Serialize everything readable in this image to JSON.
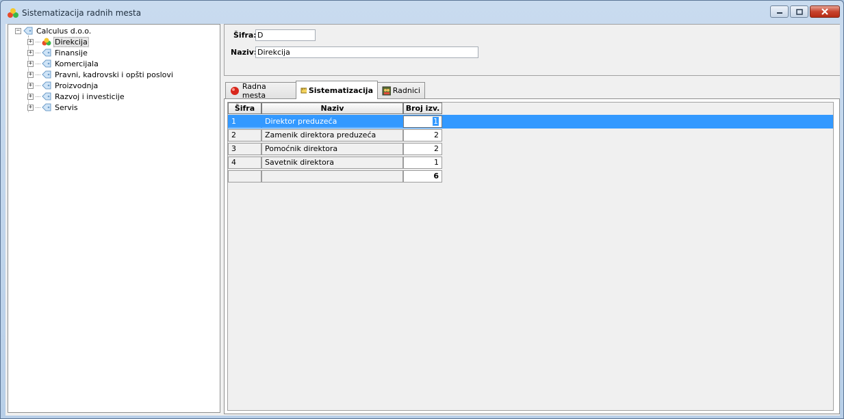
{
  "window": {
    "title": "Sistematizacija radnih mesta",
    "buttons": {
      "minimize": "minimize-icon",
      "maximize": "maximize-icon",
      "close": "close-icon"
    }
  },
  "tree": {
    "root": {
      "label": "Calculus d.o.o.",
      "expanded": true
    },
    "items": [
      {
        "label": "Direkcija",
        "selected": true
      },
      {
        "label": "Finansije"
      },
      {
        "label": "Komercijala"
      },
      {
        "label": "Pravni, kadrovski i opšti poslovi"
      },
      {
        "label": "Proizvodnja"
      },
      {
        "label": "Razvoj i investicije"
      },
      {
        "label": "Servis"
      }
    ]
  },
  "form": {
    "sifra_label": "Šifra:",
    "sifra_value": "D",
    "naziv_label": "Naziv:",
    "naziv_value": "Direkcija"
  },
  "tabs": [
    {
      "label": "Radna mesta",
      "icon": "red-ball-icon"
    },
    {
      "label": "Sistematizacija",
      "icon": "ruler-icon",
      "active": true
    },
    {
      "label": "Radnici",
      "icon": "workers-icon"
    }
  ],
  "grid": {
    "columns": [
      "Šifra",
      "Naziv",
      "Broj izv."
    ],
    "rows": [
      {
        "sifra": "1",
        "naziv": "Direktor preduzeća",
        "broj": "1",
        "selected": true
      },
      {
        "sifra": "2",
        "naziv": "Zamenik direktora preduzeća",
        "broj": "2"
      },
      {
        "sifra": "3",
        "naziv": "Pomoćnik direktora",
        "broj": "2"
      },
      {
        "sifra": "4",
        "naziv": "Savetnik direktora",
        "broj": "1"
      }
    ],
    "total": "6"
  },
  "colors": {
    "selection": "#3399ff",
    "window_frame": "#b8cfe8",
    "close_button": "#c7432e"
  }
}
